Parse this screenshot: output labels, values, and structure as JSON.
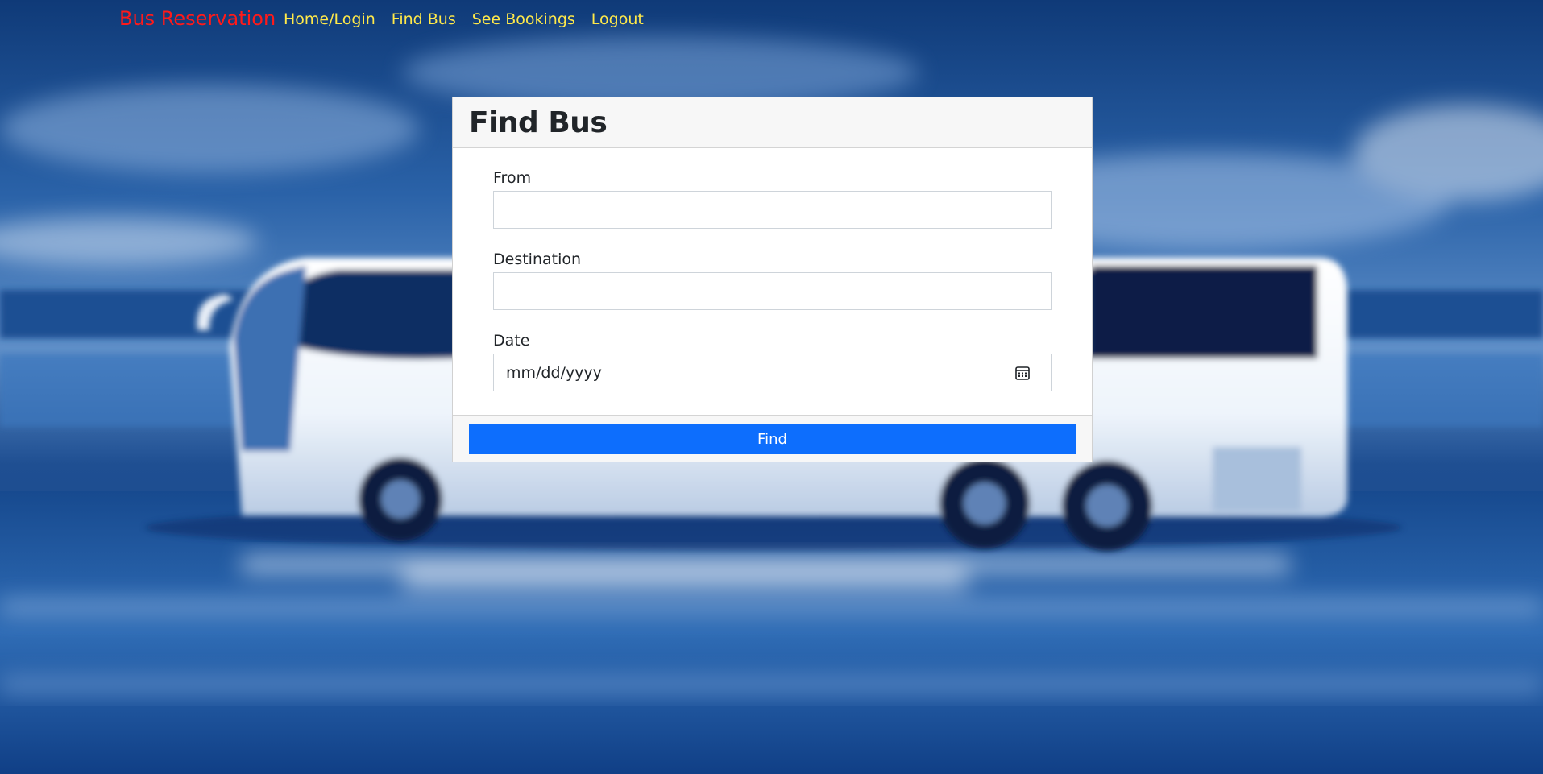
{
  "navbar": {
    "brand": "Bus Reservation",
    "links": [
      "Home/Login",
      "Find Bus",
      "See Bookings",
      "Logout"
    ]
  },
  "card": {
    "title": "Find Bus",
    "fields": {
      "from_label": "From",
      "from_value": "",
      "destination_label": "Destination",
      "destination_value": "",
      "date_label": "Date",
      "date_placeholder": "mm/dd/yyyy"
    },
    "button_label": "Find"
  },
  "colors": {
    "brand": "#ff1a1a",
    "nav_link": "#ffe94a",
    "button": "#0d6efd",
    "background": "#1b4c8f"
  },
  "background_image": "blurred-bus-on-highway"
}
